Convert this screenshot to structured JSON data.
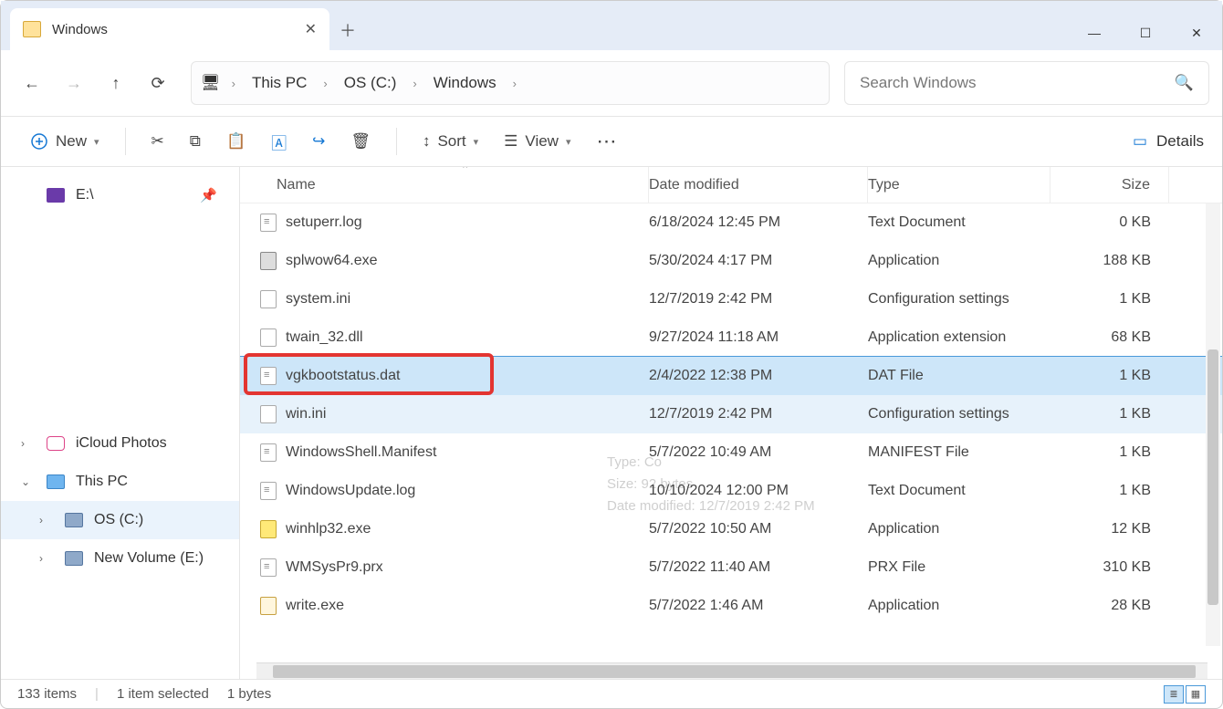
{
  "window": {
    "tab_title": "Windows"
  },
  "breadcrumb": {
    "root": "This PC",
    "drive": "OS (C:)",
    "folder": "Windows"
  },
  "search": {
    "placeholder": "Search Windows"
  },
  "toolbar": {
    "new": "New",
    "sort": "Sort",
    "view": "View",
    "details": "Details"
  },
  "sidebar": {
    "quick_e": "E:\\",
    "icloud": "iCloud Photos",
    "thispc": "This PC",
    "osc": "OS (C:)",
    "newvol": "New Volume (E:)"
  },
  "columns": {
    "name": "Name",
    "date": "Date modified",
    "type": "Type",
    "size": "Size"
  },
  "files": [
    {
      "name": "setuperr.log",
      "date": "6/18/2024 12:45 PM",
      "type": "Text Document",
      "size": "0 KB",
      "icon": "txt"
    },
    {
      "name": "splwow64.exe",
      "date": "5/30/2024 4:17 PM",
      "type": "Application",
      "size": "188 KB",
      "icon": "prn"
    },
    {
      "name": "system.ini",
      "date": "12/7/2019 2:42 PM",
      "type": "Configuration settings",
      "size": "1 KB",
      "icon": "cfg"
    },
    {
      "name": "twain_32.dll",
      "date": "9/27/2024 11:18 AM",
      "type": "Application extension",
      "size": "68 KB",
      "icon": "cfg"
    },
    {
      "name": "vgkbootstatus.dat",
      "date": "2/4/2022 12:38 PM",
      "type": "DAT File",
      "size": "1 KB",
      "icon": "txt",
      "selected": true,
      "highlight": true
    },
    {
      "name": "win.ini",
      "date": "12/7/2019 2:42 PM",
      "type": "Configuration settings",
      "size": "1 KB",
      "icon": "cfg",
      "hover": true
    },
    {
      "name": "WindowsShell.Manifest",
      "date": "5/7/2022 10:49 AM",
      "type": "MANIFEST File",
      "size": "1 KB",
      "icon": "txt"
    },
    {
      "name": "WindowsUpdate.log",
      "date": "10/10/2024 12:00 PM",
      "type": "Text Document",
      "size": "1 KB",
      "icon": "txt"
    },
    {
      "name": "winhlp32.exe",
      "date": "5/7/2022 10:50 AM",
      "type": "Application",
      "size": "12 KB",
      "icon": "hlp"
    },
    {
      "name": "WMSysPr9.prx",
      "date": "5/7/2022 11:40 AM",
      "type": "PRX File",
      "size": "310 KB",
      "icon": "txt"
    },
    {
      "name": "write.exe",
      "date": "5/7/2022 1:46 AM",
      "type": "Application",
      "size": "28 KB",
      "icon": "wr"
    }
  ],
  "tooltip_ghost": {
    "l1": "Type: Co",
    "l2": "Size: 92 bytes",
    "l3": "Date modified: 12/7/2019 2:42 PM"
  },
  "status": {
    "items": "133 items",
    "selection": "1 item selected",
    "bytes": "1 bytes"
  }
}
